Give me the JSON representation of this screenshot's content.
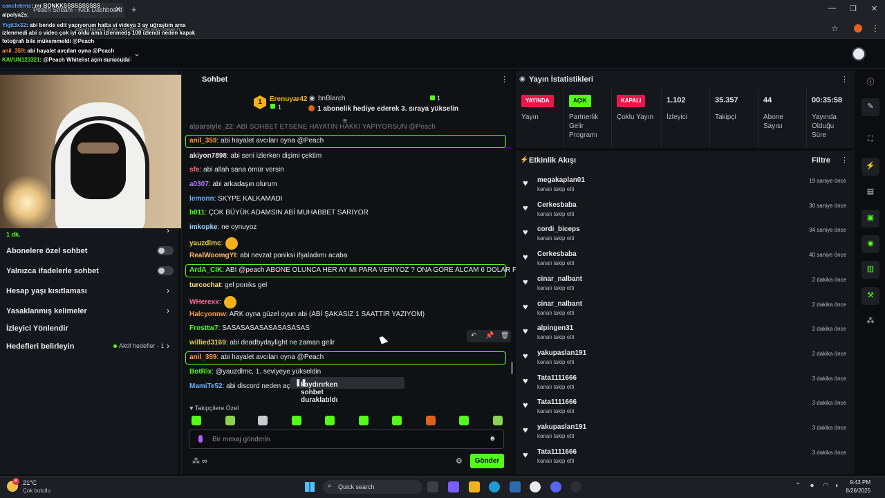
{
  "browser": {
    "tab_title": "Peach Stream - Kick Dashboard",
    "url": "dashboard.kick.com/moderator/peach"
  },
  "header": {
    "ghost_text": "Hesabı İstatisti"
  },
  "overlay_chat": [
    {
      "user": "cancletrms",
      "text": ": mr BONKKSSSSSSSSSS"
    },
    {
      "user": "alpalya2s",
      "text": ":"
    },
    {
      "user": "Yigit3x32",
      "text": ": abi bende edit yapıyorum hatta vi videya 3 ay uğraştım ama"
    },
    {
      "user": "",
      "text": "izlenmedi abi o video çok iyi oldu ama izlenmedş 100 izlendi neden kapak"
    },
    {
      "user": "",
      "text": "fotoğrafı bile mükemmeldi @Peach"
    },
    {
      "user": "anil_359",
      "text": ": abi hayalet avcıları oyna @Peach"
    },
    {
      "user": "KAVUN123321",
      "text": ": @Peach Whitelist açın sunucuda"
    }
  ],
  "sidebar": {
    "partial_sub": "1 dk.",
    "items": [
      {
        "label": "Abonelere özel sohbet",
        "control": "toggle"
      },
      {
        "label": "Yalnızca ifadelerle sohbet",
        "control": "toggle"
      },
      {
        "label": "Hesap yaşı kısıtlaması",
        "control": "chevron"
      },
      {
        "label": "Yasaklanmış kelimeler",
        "control": "chevron"
      },
      {
        "label": "İzleyici Yönlendir",
        "control": "none"
      },
      {
        "label": "Hedefleri belirleyin",
        "control": "chevron",
        "badge": "Aktif hedefler - 1"
      }
    ]
  },
  "chat": {
    "title": "Sohbet",
    "pinned": {
      "gifter": "Erenuyar42",
      "gifter_rank": "1",
      "gifter_count": "1",
      "user": "bnBlarch",
      "user_count": "1",
      "message": "1 abonelik hediye ederek 3. sıraya yükselin"
    },
    "messages": [
      {
        "user": "alparsiyle_22",
        "text": ": ABI SOHBET ETSENE HAYATIN HAKKI YAPIYORSUN @Peach",
        "color": "#cfd3d8",
        "hl": false
      },
      {
        "user": "anil_359",
        "text": ": abi hayalet avcıları oyna @Peach",
        "color": "#ff9b3d",
        "hl": true
      },
      {
        "user": "akiyon7898",
        "text": ": abi seni izlerken dişimi çektim",
        "color": "#e8eaed",
        "hl": false
      },
      {
        "user": "sfe",
        "text": ": abi allah sana ömür versin",
        "color": "#ff6b6b",
        "hl": false
      },
      {
        "user": "a0307",
        "text": ": abi arkadaşın olurum",
        "color": "#b57aff",
        "hl": false
      },
      {
        "user": "lemonn",
        "text": ": SKYPE KALKAMADI",
        "color": "#6ab0ff",
        "hl": false
      },
      {
        "user": "b011",
        "text": ": ÇOK BÜYÜK ADAMSIN ABİ MUHABBET SARIYOR",
        "color": "#53fc18",
        "hl": false
      },
      {
        "user": "imkopke",
        "text": ": ne oynuyoz",
        "color": "#9bd4ff",
        "hl": false
      },
      {
        "user": "yauzdlmc",
        "text": ":",
        "color": "#e6d04b",
        "hl": false,
        "emote": true
      },
      {
        "user": "RealWoomgYt",
        "text": ": abi nevzat poniksi ifşaladımı acaba",
        "color": "#ffb86b",
        "hl": false
      },
      {
        "user": "ArdA_CIK",
        "text": ": ABİ @peach ABONE OLUNCA HER AY MI PARA VERİYOZ ? ONA GÖRE ALCAM 6 DOLAR FAZLA",
        "color": "#53fc18",
        "hl": true
      },
      {
        "user": "turcochat",
        "text": ": gel poniks gel",
        "color": "#ffe08a",
        "hl": false
      },
      {
        "user": "WHerexx",
        "text": ":",
        "color": "#ff6b9b",
        "hl": false,
        "emote": true
      },
      {
        "user": "Halcyonnw",
        "text": ": ARK oyna güzel oyun abi (ABİ ŞAKASIZ 1 SAATTİR YAZIYOM)",
        "color": "#ff9b3d",
        "hl": false
      },
      {
        "user": "Frosttw7",
        "text": ": SASASASASASASASASAS",
        "color": "#53fc18",
        "hl": false
      },
      {
        "user": "willied3169",
        "text": ": abi deadbydaylight ne zaman gelir",
        "color": "#e6d04b",
        "hl": false
      },
      {
        "user": "anil_359",
        "text": ": abi hayalet avcıları oyna @Peach",
        "color": "#ff9b3d",
        "hl": true
      },
      {
        "user": "BotRix",
        "text": ": @yauzdlmc, 1. seviyeye yükseldin",
        "color": "#53fc18",
        "hl": false
      },
      {
        "user": "MamiTe52",
        "text": ": abi discord neden açılm",
        "color": "#6ab0ff",
        "hl": false
      }
    ],
    "paused_label": "kaydırırken sohbet duraklatıldı",
    "followers_only": "Takipçilere Özel",
    "input_placeholder": "Bir mesaj gönderin",
    "send_label": "Gönder"
  },
  "stats": {
    "title": "Yayın İstatistikleri",
    "columns": [
      {
        "pill": "YAYINDA",
        "pill_color": "#e8174a",
        "label": "Yayın"
      },
      {
        "pill": "AÇIK",
        "pill_color": "#53fc18",
        "label": "Partnerlik Gelir Programı"
      },
      {
        "pill": "KAPALI",
        "pill_color": "#e8174a",
        "label": "Çoklu Yayın"
      },
      {
        "value": "1.102",
        "label": "İzleyici"
      },
      {
        "value": "35.357",
        "label": "Takipçi"
      },
      {
        "value": "44",
        "label": "Abone Sayısı"
      },
      {
        "value": "00:35:58",
        "label": "Yayında Olduğu Süre"
      }
    ]
  },
  "feed": {
    "title": "Etkinlik Akışı",
    "filter_label": "Filtre",
    "items": [
      {
        "name": "megakaplan01",
        "action": "kanalı takip etti",
        "time": "19 saniye önce"
      },
      {
        "name": "Cerkesbaba",
        "action": "kanalı takip etti",
        "time": "30 saniye önce"
      },
      {
        "name": "cordi_biceps",
        "action": "kanalı takip etti",
        "time": "34 saniye önce"
      },
      {
        "name": "Cerkesbaba",
        "action": "kanalı takip etti",
        "time": "40 saniye önce"
      },
      {
        "name": "cinar_nalbant",
        "action": "kanalı takip etti",
        "time": "2 dakika önce"
      },
      {
        "name": "cinar_nalbant",
        "action": "kanalı takip etti",
        "time": "2 dakika önce"
      },
      {
        "name": "alpingen31",
        "action": "kanalı takip etti",
        "time": "2 dakika önce"
      },
      {
        "name": "yakupaslan191",
        "action": "kanalı takip etti",
        "time": "2 dakika önce"
      },
      {
        "name": "Tata1111666",
        "action": "kanalı takip etti",
        "time": "3 dakika önce"
      },
      {
        "name": "Tata1111666",
        "action": "kanalı takip etti",
        "time": "3 dakika önce"
      },
      {
        "name": "yakupaslan191",
        "action": "kanalı takip etti",
        "time": "3 dakika önce"
      },
      {
        "name": "Tata1111666",
        "action": "kanalı takip etti",
        "time": "3 dakika önce"
      }
    ]
  },
  "taskbar": {
    "weather_temp": "21°C",
    "weather_desc": "Çok bulutlu",
    "weather_badge": "8",
    "search_label": "Quick search",
    "time": "9:43 PM",
    "date": "8/26/2025"
  },
  "colors": {
    "accent": "#53fc18",
    "live": "#e8174a"
  }
}
